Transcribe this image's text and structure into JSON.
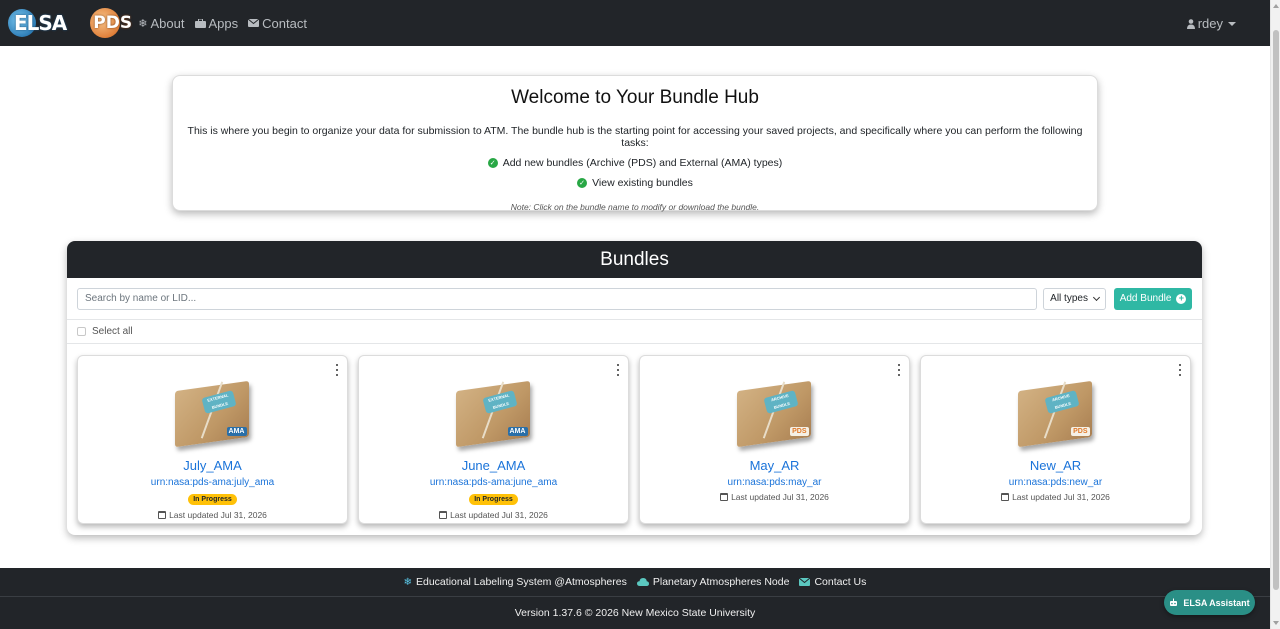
{
  "nav": {
    "logo_elsa": "ELSA",
    "logo_pds": "PDS",
    "links": [
      {
        "label": "About",
        "icon": "snowflake-icon"
      },
      {
        "label": "Apps",
        "icon": "briefcase-icon"
      },
      {
        "label": "Contact",
        "icon": "envelope-icon"
      }
    ],
    "user": "rdey",
    "user_icon": "user-icon"
  },
  "welcome": {
    "title": "Welcome to Your Bundle Hub",
    "description": "This is where you begin to organize your data for submission to ATM. The bundle hub is the starting point for accessing your saved projects, and specifically where you can perform the following tasks:",
    "tasks": [
      "Add new bundles (Archive (PDS) and External (AMA) types)",
      "View existing bundles"
    ],
    "note": "Note: Click on the bundle name to modify or download the bundle."
  },
  "bundles": {
    "title": "Bundles",
    "search_placeholder": "Search by name or LID...",
    "type_filter": "All types",
    "add_button": "Add Bundle",
    "select_all": "Select all",
    "items": [
      {
        "name": "July_AMA",
        "lid": "urn:nasa:pds-ama:july_ama",
        "status": "In Progress",
        "updated": "Last updated Jul 31, 2026",
        "tag": "EXTERNAL BUNDLE",
        "brand": "AMA"
      },
      {
        "name": "June_AMA",
        "lid": "urn:nasa:pds-ama:june_ama",
        "status": "In Progress",
        "updated": "Last updated Jul 31, 2026",
        "tag": "EXTERNAL BUNDLE",
        "brand": "AMA"
      },
      {
        "name": "May_AR",
        "lid": "urn:nasa:pds:may_ar",
        "status": "",
        "updated": "Last updated Jul 31, 2026",
        "tag": "ARCHIVE BUNDLE",
        "brand": "PDS"
      },
      {
        "name": "New_AR",
        "lid": "urn:nasa:pds:new_ar",
        "status": "",
        "updated": "Last updated Jul 31, 2026",
        "tag": "ARCHIVE BUNDLE",
        "brand": "PDS"
      }
    ]
  },
  "footer": {
    "links": [
      {
        "label": "Educational Labeling System @Atmospheres",
        "icon": "snowflake-icon"
      },
      {
        "label": "Planetary Atmospheres Node",
        "icon": "cloud-icon"
      },
      {
        "label": "Contact Us",
        "icon": "envelope-icon"
      }
    ],
    "version": "Version 1.37.6 © 2026 New Mexico State University"
  },
  "assistant": {
    "label": "ELSA Assistant",
    "icon": "robot-icon"
  },
  "colors": {
    "navbar": "#222529",
    "accent_teal": "#2fb8a4",
    "link_blue": "#1a73d9",
    "badge_yellow": "#ffc107",
    "check_green": "#28a745",
    "assistant": "#2a8f86"
  }
}
